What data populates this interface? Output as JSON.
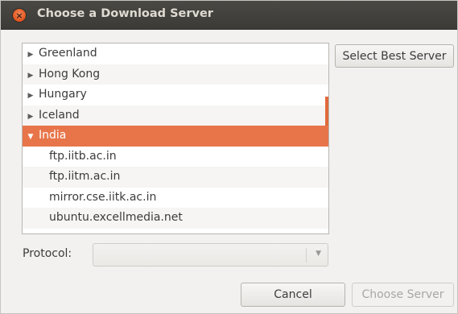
{
  "window": {
    "title": "Choose a Download Server",
    "close_glyph": "×"
  },
  "server_list": {
    "rows": [
      {
        "label": "Greenland",
        "type": "country",
        "expanded": false,
        "arrow": "▶"
      },
      {
        "label": "Hong Kong",
        "type": "country",
        "expanded": false,
        "arrow": "▶"
      },
      {
        "label": "Hungary",
        "type": "country",
        "expanded": false,
        "arrow": "▶"
      },
      {
        "label": "Iceland",
        "type": "country",
        "expanded": false,
        "arrow": "▶"
      },
      {
        "label": "India",
        "type": "country",
        "expanded": true,
        "selected": true,
        "arrow": "▼"
      },
      {
        "label": "ftp.iitb.ac.in",
        "type": "server"
      },
      {
        "label": "ftp.iitm.ac.in",
        "type": "server"
      },
      {
        "label": "mirror.cse.iitk.ac.in",
        "type": "server"
      },
      {
        "label": "ubuntu.excellmedia.net",
        "type": "server"
      }
    ]
  },
  "buttons": {
    "select_best": "Select Best Server",
    "cancel": "Cancel",
    "choose": "Choose Server"
  },
  "protocol": {
    "label": "Protocol:",
    "value": "",
    "dropdown_glyph": "▼"
  },
  "colors": {
    "accent": "#e8754a",
    "titlebar": "#3c3b37",
    "background": "#f2f1f0"
  }
}
